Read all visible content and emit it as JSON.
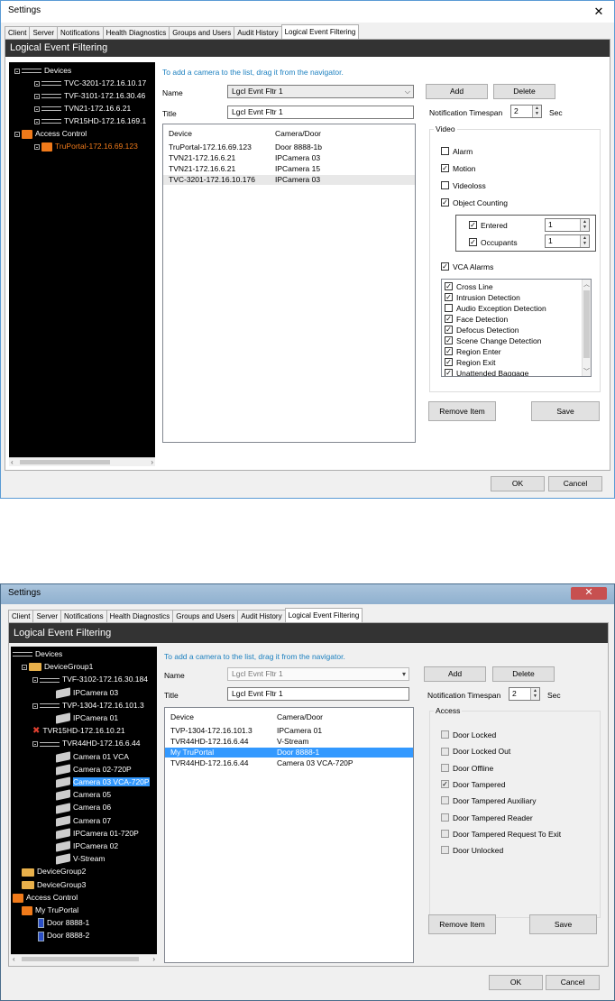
{
  "win1": {
    "title": "Settings",
    "close": "✕",
    "tabs": [
      "Client",
      "Server",
      "Notifications",
      "Health Diagnostics",
      "Groups and Users",
      "Audit History",
      "Logical Event Filtering"
    ],
    "panel_title": "Logical Event Filtering",
    "tree": [
      {
        "label": "Devices"
      },
      {
        "label": "TVC-3201-172.16.10.17"
      },
      {
        "label": "TVF-3101-172.16.30.46"
      },
      {
        "label": "TVN21-172.16.6.21"
      },
      {
        "label": "TVR15HD-172.16.169.1"
      },
      {
        "label": "Access Control"
      },
      {
        "label": "TruPortal-172.16.69.123"
      }
    ],
    "hint": "To add a camera to the list, drag it from the navigator.",
    "name_label": "Name",
    "name_value": "Lgcl Evnt Fltr 1",
    "title_label": "Title",
    "title_value": "Lgcl Evnt Fltr 1",
    "add": "Add",
    "delete": "Delete",
    "timespan_label": "Notification Timespan",
    "timespan_value": "2",
    "timespan_unit": "Sec",
    "col_device": "Device",
    "col_camera": "Camera/Door",
    "rows": [
      {
        "device": "TruPortal-172.16.69.123",
        "camera": "Door 8888-1b"
      },
      {
        "device": "TVN21-172.16.6.21",
        "camera": "IPCamera 03"
      },
      {
        "device": "TVN21-172.16.6.21",
        "camera": "IPCamera 15"
      },
      {
        "device": "TVC-3201-172.16.10.176",
        "camera": "IPCamera 03"
      }
    ],
    "group_label": "Video",
    "video_checks": [
      {
        "label": "Alarm",
        "checked": false
      },
      {
        "label": "Motion",
        "checked": true
      },
      {
        "label": "Videoloss",
        "checked": false
      },
      {
        "label": "Object Counting",
        "checked": true
      }
    ],
    "entered": {
      "label": "Entered",
      "value": "1"
    },
    "occupants": {
      "label": "Occupants",
      "value": "1"
    },
    "vca_label": "VCA Alarms",
    "vca_items": [
      {
        "label": "Cross Line",
        "checked": true
      },
      {
        "label": "Intrusion Detection",
        "checked": true
      },
      {
        "label": "Audio Exception Detection",
        "checked": false
      },
      {
        "label": "Face Detection",
        "checked": true
      },
      {
        "label": "Defocus Detection",
        "checked": true
      },
      {
        "label": "Scene Change Detection",
        "checked": true
      },
      {
        "label": "Region Enter",
        "checked": true
      },
      {
        "label": "Region Exit",
        "checked": true
      },
      {
        "label": "Unattended Baggage",
        "checked": true
      }
    ],
    "remove_item": "Remove Item",
    "save": "Save",
    "ok": "OK",
    "cancel": "Cancel"
  },
  "win2": {
    "title": "Settings",
    "close": "✕",
    "tabs": [
      "Client",
      "Server",
      "Notifications",
      "Health Diagnostics",
      "Groups and Users",
      "Audit History",
      "Logical Event Filtering"
    ],
    "panel_title": "Logical Event Filtering",
    "tree": [
      {
        "label": "Devices"
      },
      {
        "label": "DeviceGroup1"
      },
      {
        "label": "TVF-3102-172.16.30.184"
      },
      {
        "label": "IPCamera 03"
      },
      {
        "label": "TVP-1304-172.16.101.3"
      },
      {
        "label": "IPCamera 01"
      },
      {
        "label": "TVR15HD-172.16.10.21"
      },
      {
        "label": "TVR44HD-172.16.6.44"
      },
      {
        "label": "Camera 01 VCA"
      },
      {
        "label": "Camera 02-720P"
      },
      {
        "label": "Camera 03 VCA-720P"
      },
      {
        "label": "Camera 05"
      },
      {
        "label": "Camera 06"
      },
      {
        "label": "Camera 07"
      },
      {
        "label": "IPCamera 01-720P"
      },
      {
        "label": "IPCamera 02"
      },
      {
        "label": "V-Stream"
      },
      {
        "label": "DeviceGroup2"
      },
      {
        "label": "DeviceGroup3"
      },
      {
        "label": "Access Control"
      },
      {
        "label": "My TruPortal"
      },
      {
        "label": "Door 8888-1"
      },
      {
        "label": "Door 8888-2"
      }
    ],
    "hint": "To add a camera to the list, drag it from the navigator.",
    "name_label": "Name",
    "name_value": "Lgcl Evnt Fltr 1",
    "title_label": "Title",
    "title_value": "Lgcl Evnt Fltr 1",
    "add": "Add",
    "delete": "Delete",
    "timespan_label": "Notification Timespan",
    "timespan_value": "2",
    "timespan_unit": "Sec",
    "col_device": "Device",
    "col_camera": "Camera/Door",
    "rows": [
      {
        "device": "TVP-1304-172.16.101.3",
        "camera": "IPCamera 01"
      },
      {
        "device": "TVR44HD-172.16.6.44",
        "camera": "V-Stream"
      },
      {
        "device": "My TruPortal",
        "camera": "Door 8888-1"
      },
      {
        "device": "TVR44HD-172.16.6.44",
        "camera": "Camera 03 VCA-720P"
      }
    ],
    "group_label": "Access",
    "access_checks": [
      {
        "label": "Door Locked",
        "checked": false
      },
      {
        "label": "Door Locked Out",
        "checked": false
      },
      {
        "label": "Door Offline",
        "checked": false
      },
      {
        "label": "Door Tampered",
        "checked": true
      },
      {
        "label": "Door Tampered Auxiliary",
        "checked": false
      },
      {
        "label": "Door Tampered Reader",
        "checked": false
      },
      {
        "label": "Door Tampered Request To Exit",
        "checked": false
      },
      {
        "label": "Door Unlocked",
        "checked": false
      }
    ],
    "remove_item": "Remove Item",
    "save": "Save",
    "ok": "OK",
    "cancel": "Cancel"
  },
  "colors": {
    "accent": "#3399ff",
    "close_red": "#c75050",
    "hint": "#1a7fbf",
    "orange": "#f07a1a"
  }
}
